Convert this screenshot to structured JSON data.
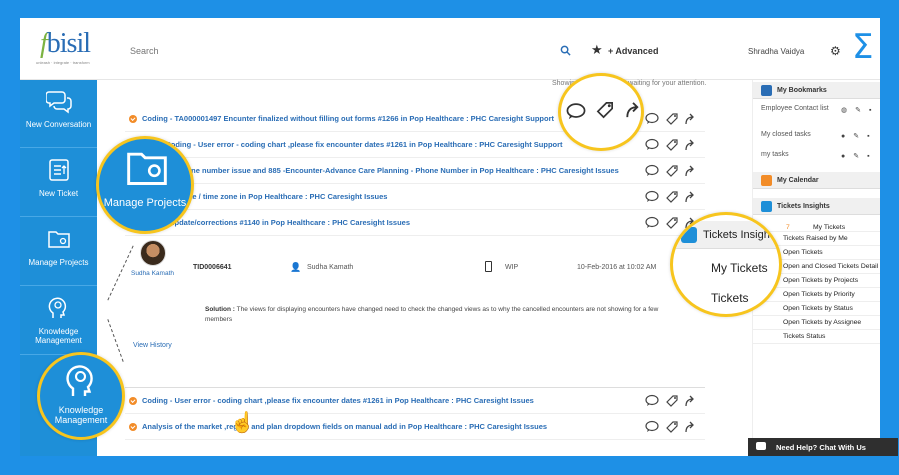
{
  "header": {
    "logo_text": "bisil",
    "logo_f": "f",
    "logo_tagline": "unleash · integrate · transform",
    "search_placeholder": "Search",
    "advanced_label": "+ Advanced",
    "user_name": "Shradha Vaidya"
  },
  "nav": {
    "items": [
      {
        "label": "New Conversation"
      },
      {
        "label": "New Ticket"
      },
      {
        "label": "Manage Projects"
      },
      {
        "label": "Knowledge Management"
      }
    ]
  },
  "content": {
    "show_note": "Showing tickets that are waiting for your attention.",
    "tickets": [
      {
        "title": "Coding - TA000001497 Encunter finalized without filling out forms #1266 in Pop Healthcare : PHC Caresight Support"
      },
      {
        "title": "#1261-Coding - User error - coding chart ,please fix encounter dates #1261 in Pop Healthcare : PHC Caresight Support"
      },
      {
        "title": "Member - phone number issue and 885 -Encounter-Advance Care Planning - Phone Number in Pop Healthcare : PHC Caresight Issues"
      },
      {
        "title": "Encounter date / time zone in Pop Healthcare : PHC Caresight Issues"
      },
      {
        "title": "Record update/corrections #1140 in Pop Healthcare : PHC Caresight Issues"
      }
    ],
    "detail": {
      "agent_name": "Sudha Kamath",
      "ticket_id": "TID0006641",
      "assignee": "Sudha Kamath",
      "status": "WIP",
      "date": "10-Feb-2016 at 10:02 AM",
      "solution_label": "Solution :",
      "solution_text": "The views for displaying encounters have changed need to check the changed views as to why the cancelled encounters are not showing for a few members",
      "view_history": "View History"
    },
    "tickets_bottom": [
      {
        "title": "Coding - User error - coding chart ,please fix encounter dates #1261 in Pop Healthcare : PHC Caresight Issues"
      },
      {
        "title": "Analysis of the market ,region and plan dropdown fields on manual add in Pop Healthcare : PHC Caresight Issues"
      }
    ]
  },
  "sidebar": {
    "bookmarks_title": "My Bookmarks",
    "bookmarks": [
      {
        "label": "Employee Contact list"
      },
      {
        "label": "My closed tasks"
      },
      {
        "label": "my tasks"
      }
    ],
    "calendar_title": "My Calendar",
    "insights_title": "Tickets Insights",
    "insights": [
      {
        "label": "My Tickets",
        "badge": "7"
      },
      {
        "label": "Tickets Raised by Me"
      },
      {
        "label": "Open Tickets"
      },
      {
        "label": "Open and Closed Tickets Detail"
      },
      {
        "label": "Open Tickets by Projects"
      },
      {
        "label": "Open Tickets by Priority"
      },
      {
        "label": "Open Tickets by Status"
      },
      {
        "label": "Open Tickets by Assignee"
      },
      {
        "label": "Tickets Status"
      }
    ]
  },
  "callouts": {
    "manage_projects": "Manage Projects",
    "knowledge_management": "Knowledge Management",
    "tickets_insights": "Tickets Insights",
    "my_tickets": "My Tickets",
    "tickets": "Tickets"
  },
  "chat": {
    "label": "Need Help? Chat With Us"
  },
  "colors": {
    "accent": "#1e90e6",
    "highlight": "#f7c51e",
    "status_dot": "#f28c28",
    "link": "#2a6db5"
  }
}
